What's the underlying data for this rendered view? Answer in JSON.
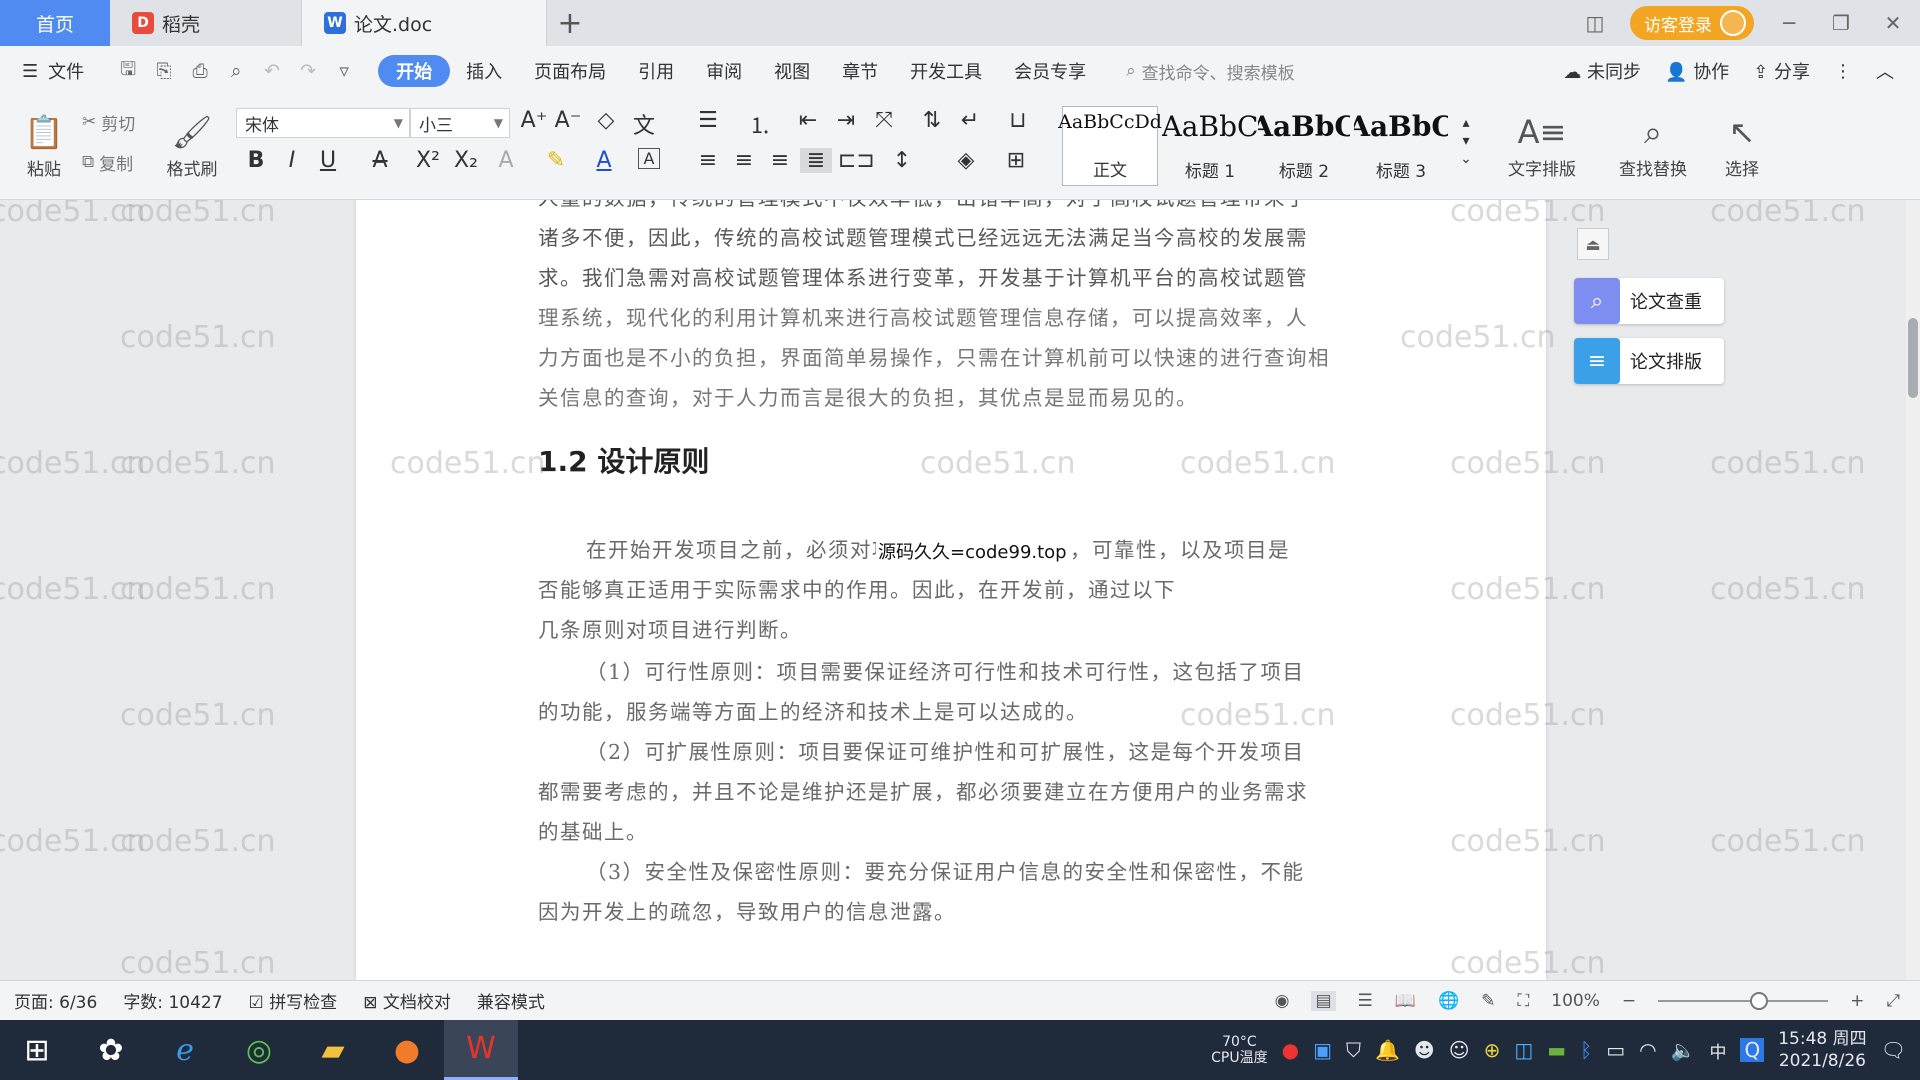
{
  "tabs": {
    "home": "首页",
    "daoke": "稻壳",
    "doc": "论文.doc",
    "add": "+"
  },
  "titlebar": {
    "login": "访客登录"
  },
  "menu": {
    "file": "文件",
    "items": [
      "开始",
      "插入",
      "页面布局",
      "引用",
      "审阅",
      "视图",
      "章节",
      "开发工具",
      "会员专享"
    ],
    "search_placeholder": "查找命令、搜索模板",
    "sync": "未同步",
    "collab": "协作",
    "share": "分享"
  },
  "ribbon": {
    "paste": "粘贴",
    "cut": "剪切",
    "copy": "复制",
    "format_painter": "格式刷",
    "font_name": "宋体",
    "font_size": "小三",
    "styles": [
      {
        "sample": "AaBbCcDd",
        "name": "正文"
      },
      {
        "sample": "AaBbC",
        "name": "标题 1"
      },
      {
        "sample": "AaBbC",
        "name": "标题 2"
      },
      {
        "sample": "AaBbC",
        "name": "标题 3"
      }
    ],
    "text_layout": "文字排版",
    "find_replace": "查找替换",
    "select": "选择"
  },
  "document": {
    "lines_top": [
      "人量的数据，传统的管理模式不仅效率低，出错率高，对于高校试题管理带来了",
      "诸多不便，因此，传统的高校试题管理模式已经远远无法满足当今高校的发展需",
      "求。我们急需对高校试题管理体系进行变革，开发基于计算机平台的高校试题管",
      "理系统，现代化的利用计算机来进行高校试题管理信息存储，可以提高效率，人",
      "力方面也是不小的负担，界面简单易操作，只需在计算机前可以快速的进行查询相",
      "关信息的查询，对于人力而言是很大的负担，其优点是显而易见的。"
    ],
    "heading": "1.2 设计原则",
    "stamp": "源码久久=code99.top",
    "lines_bottom": [
      "在开始开发项目之前，必须对项目的目的进行分析，可靠性，以及项目是",
      "否能够真正适用于实际需求中的作用。因此，在开发前，通过以下",
      "几条原则对项目进行判断。",
      "（1）可行性原则：项目需要保证经济可行性和技术可行性，这包括了项目",
      "的功能，服务端等方面上的经济和技术上是可以达成的。",
      "（2）可扩展性原则：项目要保证可维护性和可扩展性，这是每个开发项目",
      "都需要考虑的，并且不论是维护还是扩展，都必须要建立在方便用户的业务需求",
      "的基础上。",
      "（3）安全性及保密性原则：要充分保证用户信息的安全性和保密性，不能",
      "因为开发上的疏忽，导致用户的信息泄露。"
    ],
    "watermark": "code51.cn"
  },
  "side_panel": {
    "check": "论文查重",
    "layout": "论文排版"
  },
  "status": {
    "page": "页面: 6/36",
    "words": "字数: 10427",
    "spell": "拼写检查",
    "proof": "文档校对",
    "compat": "兼容模式",
    "zoom": "100%"
  },
  "taskbar": {
    "cpu_temp": "70°C",
    "cpu_label": "CPU温度",
    "ime": "中",
    "time": "15:48 周四",
    "date": "2021/8/26"
  },
  "colors": {
    "accent": "#4f8bf0",
    "login": "#f2a623",
    "taskbar": "#1f2a3a"
  }
}
